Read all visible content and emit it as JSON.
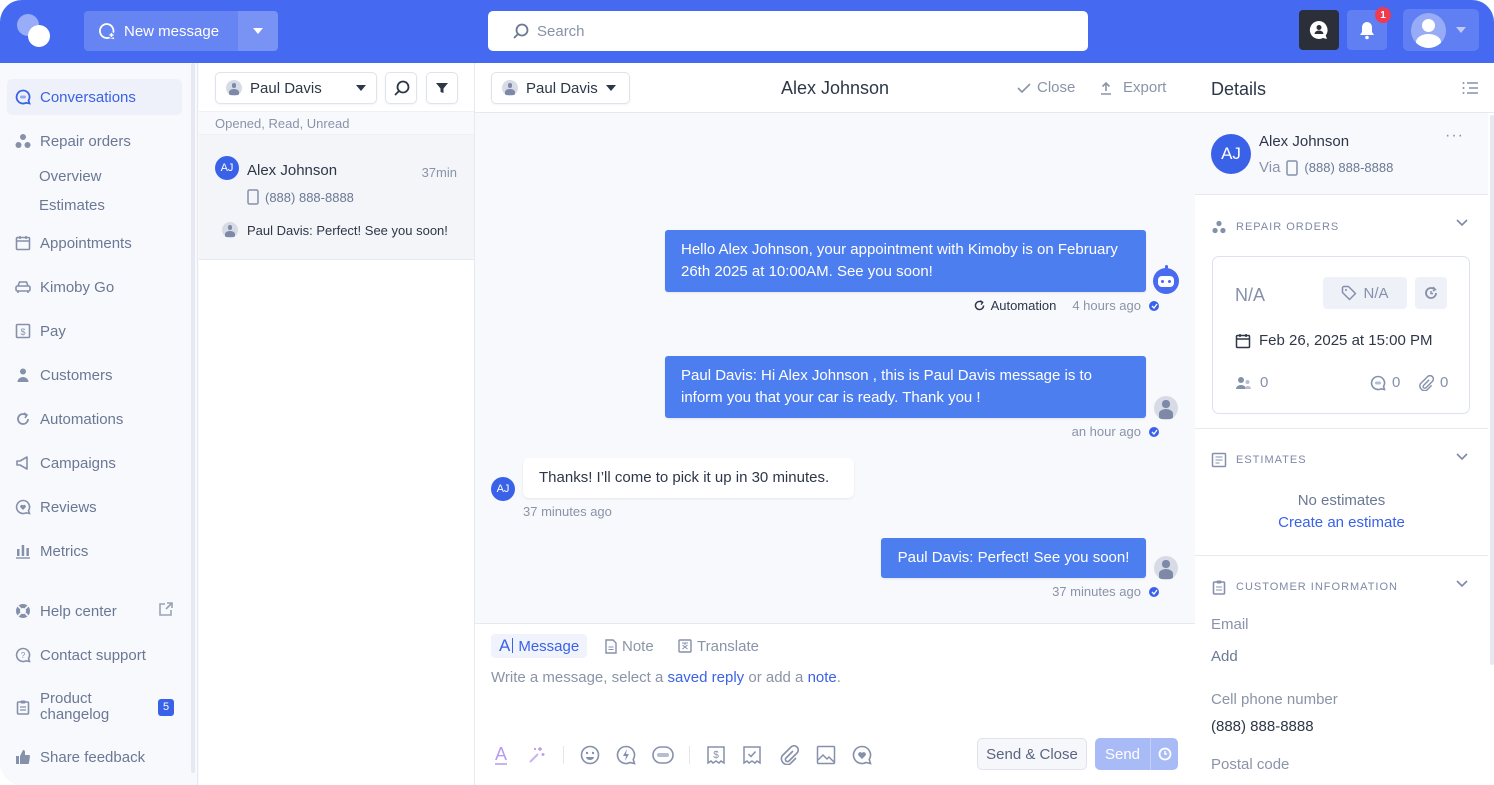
{
  "topbar": {
    "new_message_label": "New message",
    "search_placeholder": "Search",
    "notification_count": "1"
  },
  "sidebar": {
    "items": [
      {
        "label": "Conversations",
        "icon": "chat-bubble-icon",
        "active": true
      },
      {
        "label": "Repair orders",
        "icon": "repair-orders-icon"
      },
      {
        "label": "Appointments",
        "icon": "calendar-icon"
      },
      {
        "label": "Kimoby Go",
        "icon": "car-icon"
      },
      {
        "label": "Pay",
        "icon": "dollar-receipt-icon"
      },
      {
        "label": "Customers",
        "icon": "person-icon"
      },
      {
        "label": "Automations",
        "icon": "automation-icon"
      },
      {
        "label": "Campaigns",
        "icon": "megaphone-icon"
      },
      {
        "label": "Reviews",
        "icon": "heart-bubble-icon"
      },
      {
        "label": "Metrics",
        "icon": "bar-chart-icon"
      }
    ],
    "sub_items": [
      "Overview",
      "Estimates"
    ],
    "footer": [
      {
        "label": "Help center",
        "icon": "lifebuoy-icon"
      },
      {
        "label": "Contact support",
        "icon": "question-bubble-icon"
      },
      {
        "label_line1": "Product",
        "label_line2": "changelog",
        "icon": "clipboard-icon",
        "badge": "5"
      },
      {
        "label": "Share feedback",
        "icon": "thumbs-up-icon"
      }
    ]
  },
  "list": {
    "agent": "Paul Davis",
    "filter_text": "Opened, Read, Unread",
    "conversations": [
      {
        "initials": "AJ",
        "name": "Alex Johnson",
        "time": "37min",
        "phone": "(888) 888-8888",
        "preview": "Paul Davis: Perfect! See you soon!"
      }
    ]
  },
  "chat": {
    "agent": "Paul Davis",
    "title": "Alex Johnson",
    "close_label": "Close",
    "export_label": "Export",
    "messages": [
      {
        "direction": "out",
        "text": "Hello Alex Johnson, your appointment with Kimoby is on February 26th 2025 at 10:00AM. See you soon!",
        "source": "Automation",
        "time": "4 hours ago"
      },
      {
        "direction": "out",
        "text": "Paul Davis: Hi Alex Johnson , this is Paul Davis message is to inform you that your car is ready. Thank you !",
        "time": "an hour ago"
      },
      {
        "direction": "in",
        "initials": "AJ",
        "text": "Thanks! I’ll come to pick it up in 30 minutes.",
        "time": "37 minutes ago"
      },
      {
        "direction": "out",
        "text": "Paul Davis: Perfect! See you soon!",
        "time": "37 minutes ago"
      }
    ],
    "composer": {
      "tabs": [
        "Message",
        "Note",
        "Translate"
      ],
      "placeholder_1": "Write a message, select a ",
      "placeholder_link1": "saved reply",
      "placeholder_2": " or add a ",
      "placeholder_link2": "note",
      "placeholder_3": ".",
      "send_close_label": "Send & Close",
      "send_label": "Send"
    }
  },
  "details": {
    "title": "Details",
    "contact": {
      "initials": "AJ",
      "name": "Alex Johnson",
      "via": "Via",
      "phone": "(888) 888-8888"
    },
    "repair_orders": {
      "heading": "REPAIR ORDERS",
      "number": "N/A",
      "tag": "N/A",
      "date": "Feb 26, 2025 at 15:00 PM",
      "people_count": "0",
      "comments_count": "0",
      "attachments_count": "0"
    },
    "estimates": {
      "heading": "ESTIMATES",
      "empty": "No estimates",
      "create_link": "Create an estimate"
    },
    "customer_info": {
      "heading": "CUSTOMER INFORMATION",
      "fields": [
        {
          "label": "Email",
          "value": "Add"
        },
        {
          "label": "Cell phone number",
          "value": "(888) 888-8888"
        },
        {
          "label": "Postal code",
          "value": ""
        }
      ]
    }
  },
  "colors": {
    "brand": "#4569f0",
    "accent": "#3a62e8",
    "bubble": "#4d7ef0",
    "badge_red": "#ef3a4f"
  }
}
